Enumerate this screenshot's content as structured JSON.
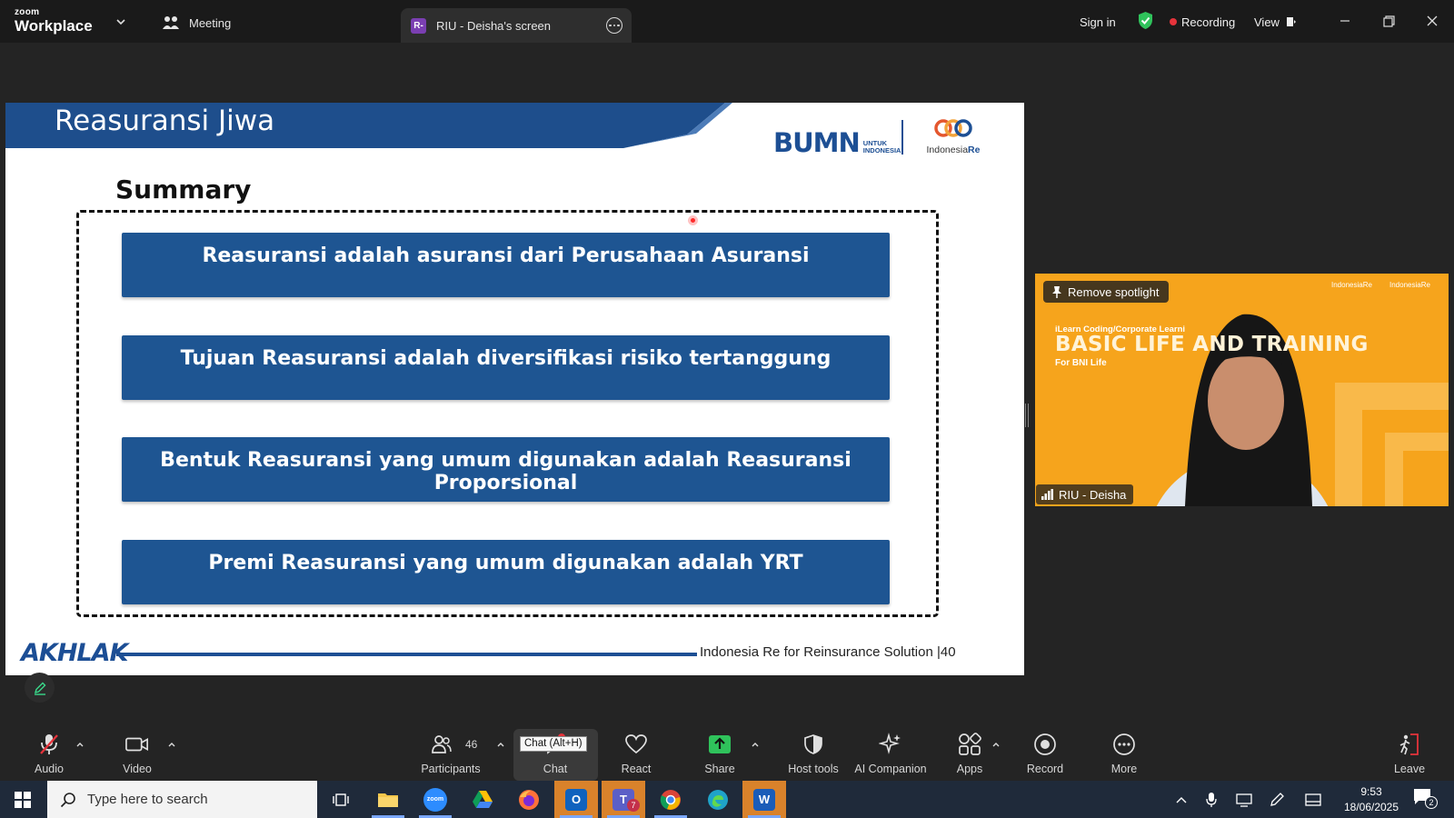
{
  "titlebar": {
    "brand_small": "zoom",
    "brand_name": "Workplace",
    "meeting_tab": "Meeting",
    "share_tab_initial": "R-",
    "share_tab_label": "RIU - Deisha's screen",
    "sign_in": "Sign in",
    "recording": "Recording",
    "view": "View"
  },
  "slide": {
    "title": "Reasuransi Jiwa",
    "logo_bumn": "BUMN",
    "logo_bumn_sub1": "UNTUK",
    "logo_bumn_sub2": "INDONESIA",
    "logo_ire_a": "Indonesia",
    "logo_ire_b": "Re",
    "heading": "Summary",
    "items": [
      "Reasuransi adalah asuransi dari Perusahaan Asuransi",
      "Tujuan Reasuransi adalah diversifikasi risiko tertanggung",
      "Bentuk Reasuransi yang umum digunakan adalah Reasuransi Proporsional",
      "Premi Reasuransi yang umum digunakan adalah YRT"
    ],
    "footer_logo": "AKHLAK",
    "footer_text": "Indonesia Re for Reinsurance Solution",
    "page_number": "|40"
  },
  "video": {
    "remove_spotlight": "Remove spotlight",
    "bg_line1": "iLearn Coding/Corporate Learni",
    "bg_line2": "BASIC LIFE AND      TRAINING",
    "bg_line3": "For BNI Life",
    "bg_logo1": "IndonesiaRe",
    "bg_logo2": "IndonesiaRe",
    "participant_name": "RIU - Deisha"
  },
  "toolbar": {
    "audio": "Audio",
    "video": "Video",
    "participants": "Participants",
    "participants_count": "46",
    "chat": "Chat",
    "chat_tooltip": "Chat (Alt+H)",
    "react": "React",
    "share": "Share",
    "host_tools": "Host tools",
    "ai_companion": "AI Companion",
    "apps": "Apps",
    "record": "Record",
    "more": "More",
    "leave": "Leave"
  },
  "taskbar": {
    "search_placeholder": "Type here to search",
    "time": "9:53",
    "date": "18/06/2025",
    "notification_count": "2",
    "zoom_label": "zoom",
    "teams_badge": "7"
  },
  "colors": {
    "slide_blue": "#1e5592",
    "video_bg": "#f6a41c",
    "recording_red": "#e5333b",
    "share_green": "#2fc25b"
  }
}
